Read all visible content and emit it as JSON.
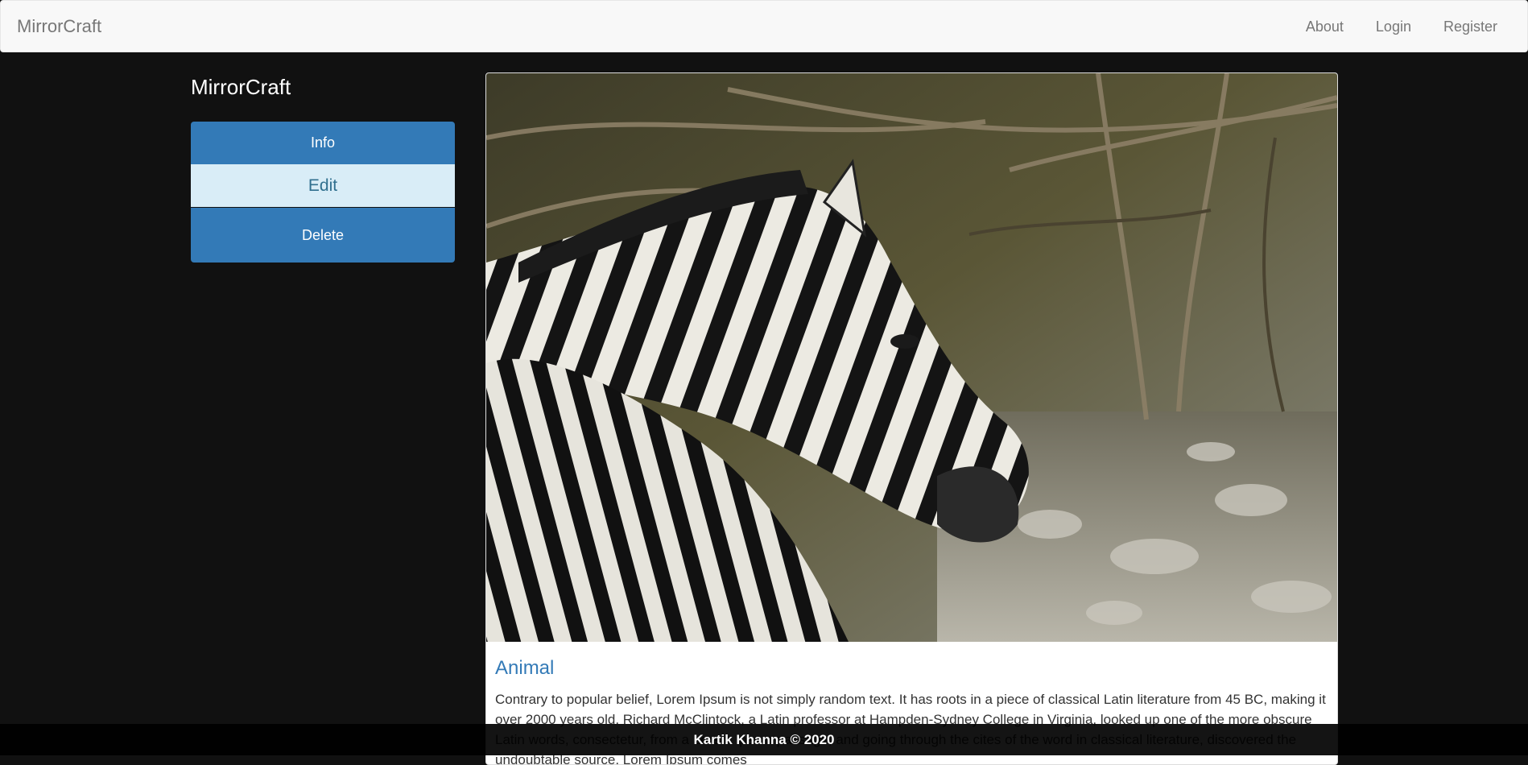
{
  "navbar": {
    "brand": "MirrorCraft",
    "links": [
      "About",
      "Login",
      "Register"
    ]
  },
  "sidebar": {
    "title": "MirrorCraft",
    "buttons": {
      "info": "Info",
      "edit": "Edit",
      "delete": "Delete"
    }
  },
  "card": {
    "image_subject": "zebra",
    "title": "Animal",
    "text": "Contrary to popular belief, Lorem Ipsum is not simply random text. It has roots in a piece of classical Latin literature from 45 BC, making it over 2000 years old. Richard McClintock, a Latin professor at Hampden-Sydney College in Virginia, looked up one of the more obscure Latin words, consectetur, from a Lorem Ipsum passage, and going through the cites of the word in classical literature, discovered the undoubtable source. Lorem Ipsum comes"
  },
  "footer": {
    "text": "Kartik Khanna © 2020"
  },
  "colors": {
    "primary": "#337ab7",
    "edit_bg": "#d9edf7",
    "edit_text": "#31708f",
    "page_bg": "#111111",
    "navbar_bg": "#f8f8f8"
  }
}
